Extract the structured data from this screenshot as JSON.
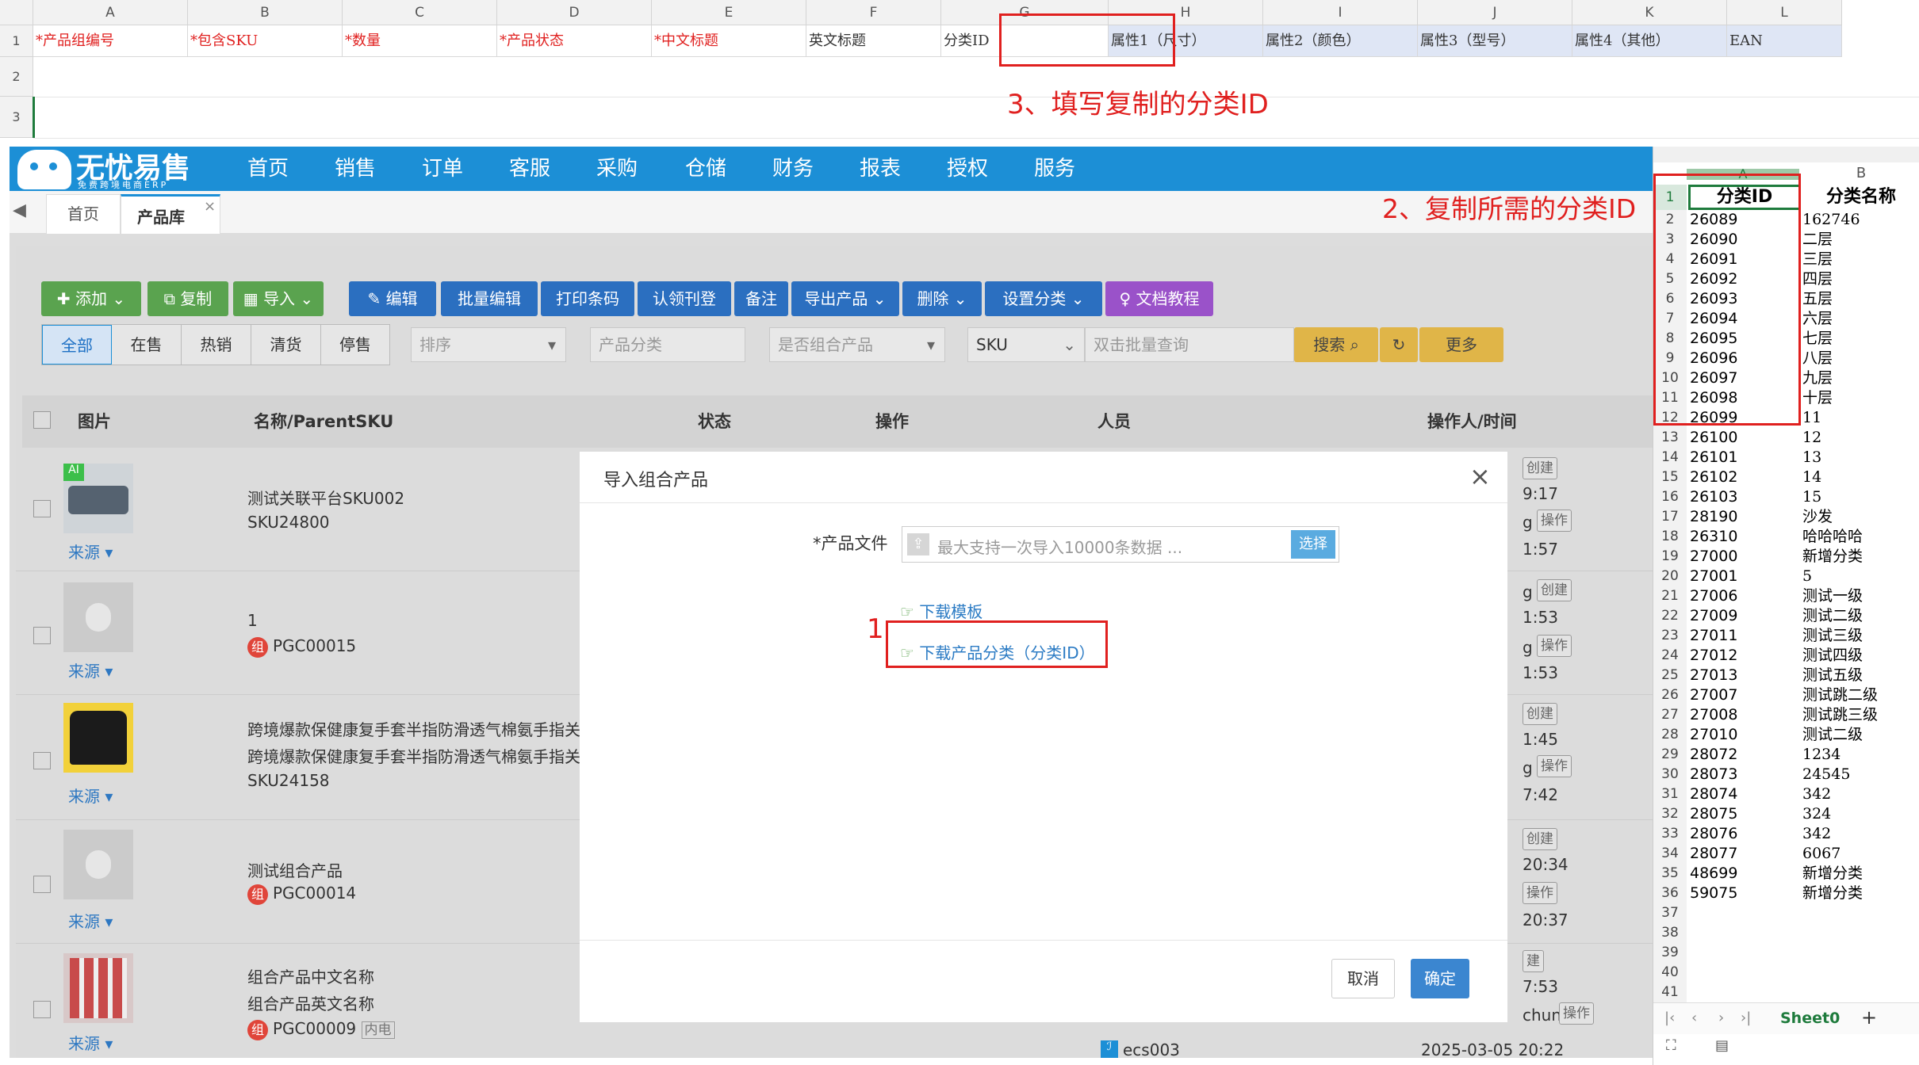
{
  "top_sheet": {
    "col_letters": [
      "A",
      "B",
      "C",
      "D",
      "E",
      "F",
      "G",
      "H",
      "I",
      "J",
      "K",
      "L"
    ],
    "row_numbers": [
      "1",
      "2",
      "3"
    ],
    "headers": [
      {
        "text": "*产品组编号",
        "required": true
      },
      {
        "text": "*包含SKU",
        "required": true
      },
      {
        "text": "*数量",
        "required": true
      },
      {
        "text": "*产品状态",
        "required": true
      },
      {
        "text": "*中文标题",
        "required": true
      },
      {
        "text": "英文标题",
        "required": false
      },
      {
        "text": "分类ID",
        "required": false
      },
      {
        "text": "属性1（尺寸）",
        "required": false
      },
      {
        "text": "属性2（颜色）",
        "required": false
      },
      {
        "text": "属性3（型号）",
        "required": false
      },
      {
        "text": "属性4（其他）",
        "required": false
      },
      {
        "text": "EAN",
        "required": false
      }
    ]
  },
  "annotations": {
    "step1": "1",
    "step2": "2、复制所需的分类ID",
    "step3": "3、填写复制的分类ID"
  },
  "app": {
    "logo_text": "无忧易售",
    "logo_sub": "免费跨境电商ERP",
    "nav": [
      "首页",
      "销售",
      "订单",
      "客服",
      "采购",
      "仓储",
      "财务",
      "报表",
      "授权",
      "服务"
    ],
    "tabs": {
      "home": "首页",
      "active": "产品库",
      "close": "×"
    },
    "toolbar": {
      "add": "添加",
      "copy": "复制",
      "import": "导入",
      "edit": "编辑",
      "batch_edit": "批量编辑",
      "print_barcode": "打印条码",
      "claim": "认领刊登",
      "remark": "备注",
      "export": "导出产品",
      "delete": "删除",
      "set_category": "设置分类",
      "docs": "文档教程"
    },
    "status_tabs": [
      "全部",
      "在售",
      "热销",
      "清货",
      "停售"
    ],
    "filters": {
      "sort": "排序",
      "category": "产品分类",
      "is_combo": "是否组合产品",
      "sku": "SKU",
      "batch_query": "双击批量查询",
      "search": "搜索",
      "more": "更多"
    },
    "table_headers": [
      "图片",
      "名称/ParentSKU",
      "状态",
      "操作",
      "人员",
      "操作人/时间"
    ],
    "rows": [
      {
        "line1": "测试关联平台SKU002",
        "line2": "SKU24800",
        "badge": "",
        "source": "来源",
        "right_frag": [
          "创建",
          "9:17",
          "g",
          "操作",
          "1:57"
        ]
      },
      {
        "line1": "1",
        "line2": "PGC00015",
        "badge": "组",
        "source": "来源",
        "right_frag": [
          "g",
          "创建",
          "1:53",
          "g",
          "操作",
          "1:53"
        ]
      },
      {
        "line1": "跨境爆款保健康复手套半指防滑透气棉氨手指关节",
        "line2": "跨境爆款保健康复手套半指防滑透气棉氨手指关节",
        "line3": "SKU24158",
        "badge": "",
        "source": "来源",
        "right_frag": [
          "创建",
          "1:45",
          "g",
          "操作",
          "7:42"
        ]
      },
      {
        "line1": "测试组合产品",
        "line2": "PGC00014",
        "badge": "组",
        "source": "来源",
        "right_frag": [
          "创建",
          "20:34",
          "操作",
          "20:37"
        ]
      },
      {
        "line1": "组合产品中文名称",
        "line2": "组合产品英文名称",
        "line3": "PGC00009",
        "tag": "内电",
        "badge": "组",
        "source": "来源",
        "right_frag": [
          "建",
          "7:53",
          "chun",
          "操作",
          "ecs003",
          "2025-03-05 20:22"
        ]
      }
    ]
  },
  "modal": {
    "title": "导入组合产品",
    "close": "×",
    "file_label": "*产品文件",
    "file_placeholder": "最大支持一次导入10000条数据 ...",
    "choose": "选择",
    "download_template": "下载模板",
    "download_category": "下载产品分类（分类ID）",
    "cancel": "取消",
    "ok": "确定"
  },
  "right_sheet": {
    "col_a": "A",
    "col_b": "B",
    "header_a": "分类ID",
    "header_b": "分类名称",
    "rows": [
      [
        "2",
        "26089",
        "162746"
      ],
      [
        "3",
        "26090",
        "二层"
      ],
      [
        "4",
        "26091",
        "三层"
      ],
      [
        "5",
        "26092",
        "四层"
      ],
      [
        "6",
        "26093",
        "五层"
      ],
      [
        "7",
        "26094",
        "六层"
      ],
      [
        "8",
        "26095",
        "七层"
      ],
      [
        "9",
        "26096",
        "八层"
      ],
      [
        "10",
        "26097",
        "九层"
      ],
      [
        "11",
        "26098",
        "十层"
      ],
      [
        "12",
        "26099",
        "11"
      ],
      [
        "13",
        "26100",
        "12"
      ],
      [
        "14",
        "26101",
        "13"
      ],
      [
        "15",
        "26102",
        "14"
      ],
      [
        "16",
        "26103",
        "15"
      ],
      [
        "17",
        "28190",
        "沙发"
      ],
      [
        "18",
        "26310",
        "哈哈哈哈"
      ],
      [
        "19",
        "27000",
        "新增分类"
      ],
      [
        "20",
        "27001",
        "5"
      ],
      [
        "21",
        "27006",
        "测试一级"
      ],
      [
        "22",
        "27009",
        "测试二级"
      ],
      [
        "23",
        "27011",
        "测试三级"
      ],
      [
        "24",
        "27012",
        "测试四级"
      ],
      [
        "25",
        "27013",
        "测试五级"
      ],
      [
        "26",
        "27007",
        "测试跳二级"
      ],
      [
        "27",
        "27008",
        "测试跳三级"
      ],
      [
        "28",
        "27010",
        "测试二级"
      ],
      [
        "29",
        "28072",
        "1234"
      ],
      [
        "30",
        "28073",
        "24545"
      ],
      [
        "31",
        "28074",
        "342"
      ],
      [
        "32",
        "28075",
        "324"
      ],
      [
        "33",
        "28076",
        "342"
      ],
      [
        "34",
        "28077",
        "6067"
      ],
      [
        "35",
        "48699",
        "新增分类"
      ],
      [
        "36",
        "59075",
        "新增分类"
      ],
      [
        "37",
        "",
        ""
      ],
      [
        "38",
        "",
        ""
      ],
      [
        "39",
        "",
        ""
      ],
      [
        "40",
        "",
        ""
      ],
      [
        "41",
        "",
        ""
      ]
    ],
    "sheet_tab": "Sheet0",
    "add": "+"
  }
}
